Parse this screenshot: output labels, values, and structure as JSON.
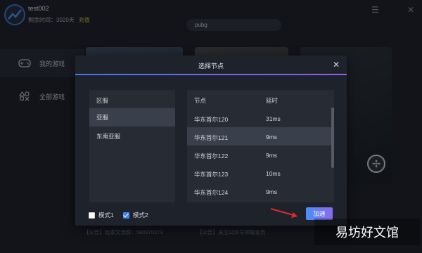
{
  "header": {
    "username": "test002",
    "remaining_label": "剩余时间：3020天",
    "recharge_label": "充值",
    "search_value": "pubg",
    "menu_icon": "☰",
    "close_icon": "✕"
  },
  "sidebar": {
    "items": [
      {
        "label": "我的游戏",
        "icon": "gamepad-icon"
      },
      {
        "label": "全部游戏",
        "icon": "grid-icon"
      }
    ]
  },
  "notices": [
    "【公告】玩家交流群：580370273",
    "【公告】关注公众号领取会员"
  ],
  "dialog": {
    "title": "选择节点",
    "close": "✕",
    "region_header": "区服",
    "regions": [
      {
        "label": "亚服",
        "selected": true
      },
      {
        "label": "东南亚服",
        "selected": false
      }
    ],
    "node_header": "节点",
    "latency_header": "延时",
    "nodes": [
      {
        "name": "华东首尔120",
        "latency": "31ms",
        "selected": false
      },
      {
        "name": "华东首尔121",
        "latency": "9ms",
        "selected": true
      },
      {
        "name": "华东首尔122",
        "latency": "9ms",
        "selected": false
      },
      {
        "name": "华东首尔123",
        "latency": "10ms",
        "selected": false
      },
      {
        "name": "华东首尔124",
        "latency": "9ms",
        "selected": false
      }
    ],
    "mode1": {
      "label": "模式1",
      "checked": false
    },
    "mode2": {
      "label": "模式2",
      "checked": true
    },
    "accelerate_label": "加速"
  },
  "watermark": "易坊好文馆",
  "colors": {
    "accent": "#3d84f5",
    "accent2": "#8b69f2",
    "arrow": "#e0282e",
    "recharge": "#e0b43a"
  }
}
